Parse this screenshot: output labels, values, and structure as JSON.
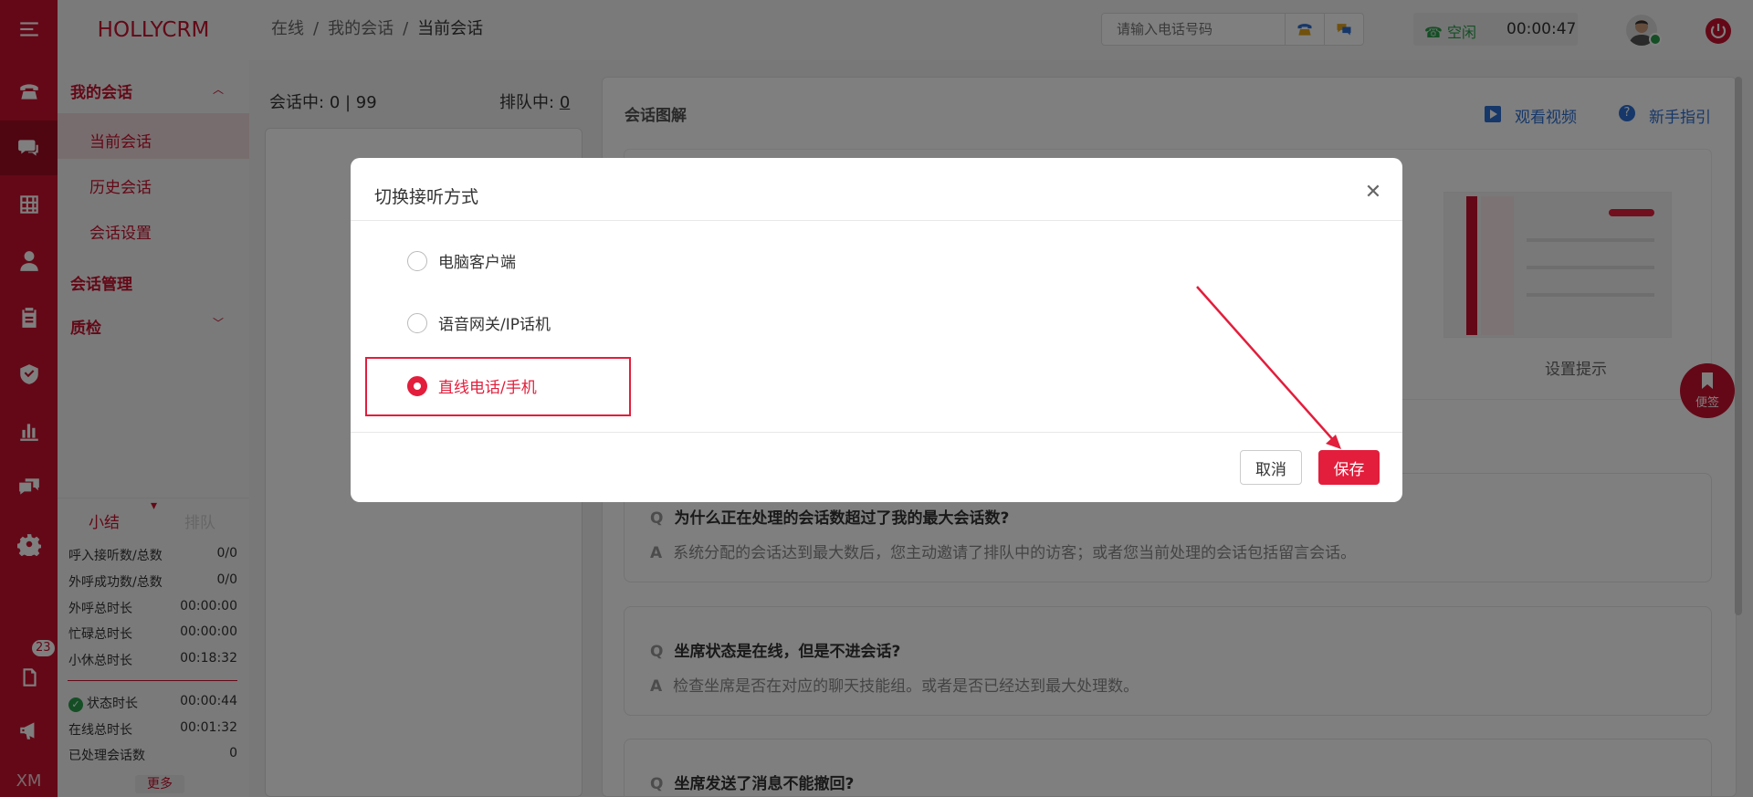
{
  "brand": "HOLLYCRM",
  "breadcrumb": {
    "a": "在线",
    "b": "我的会话",
    "c": "当前会话",
    "sep": "/"
  },
  "phone": {
    "placeholder": "请输入电话号码"
  },
  "status": {
    "state": "空闲",
    "timer": "00:00:47"
  },
  "rail": {
    "badge": "23",
    "bottom": "XM"
  },
  "menu": {
    "my_sessions": "我的会话",
    "current": "当前会话",
    "history": "历史会话",
    "settings": "会话设置",
    "manage": "会话管理",
    "qa": "质检"
  },
  "stats": {
    "tab_summary": "小结",
    "tab_queue": "排队",
    "rows": [
      {
        "label": "呼入接听数/总数",
        "value": "0/0"
      },
      {
        "label": "外呼成功数/总数",
        "value": "0/0"
      },
      {
        "label": "外呼总时长",
        "value": "00:00:00"
      },
      {
        "label": "忙碌总时长",
        "value": "00:00:00"
      },
      {
        "label": "小休总时长",
        "value": "00:18:32"
      }
    ],
    "rows2": [
      {
        "label": "状态时长",
        "value": "00:00:44"
      },
      {
        "label": "在线总时长",
        "value": "00:01:32"
      },
      {
        "label": "已处理会话数",
        "value": "0"
      }
    ],
    "more": "更多"
  },
  "sessions": {
    "in_label": "会话中:",
    "in_value": "0 | 99",
    "queue_label": "排队中:",
    "queue_value": "0"
  },
  "diagram": {
    "title": "会话图解",
    "watch_video": "观看视频",
    "guide": "新手指引",
    "thumb_caption": "设置提示"
  },
  "faq": [
    {
      "q": "为什么正在处理的会话数超过了我的最大会话数?",
      "a": "系统分配的会话达到最大数后，您主动邀请了排队中的访客；或者您当前处理的会话包括留言会话。"
    },
    {
      "q": "坐席状态是在线，但是不进会话?",
      "a": "检查坐席是否在对应的聊天技能组。或者是否已经达到最大处理数。"
    },
    {
      "q": "坐席发送了消息不能撤回?",
      "a": ""
    }
  ],
  "faq_q": "Q",
  "faq_a": "A",
  "sticky": "便签",
  "modal": {
    "title": "切换接听方式",
    "options": [
      "电脑客户端",
      "语音网关/IP话机",
      "直线电话/手机"
    ],
    "selected_index": 2,
    "cancel": "取消",
    "save": "保存"
  },
  "colors": {
    "brand": "#c8102e",
    "accent": "#e21e3c",
    "link": "#2d6fd2",
    "online": "#2a9d4a"
  }
}
